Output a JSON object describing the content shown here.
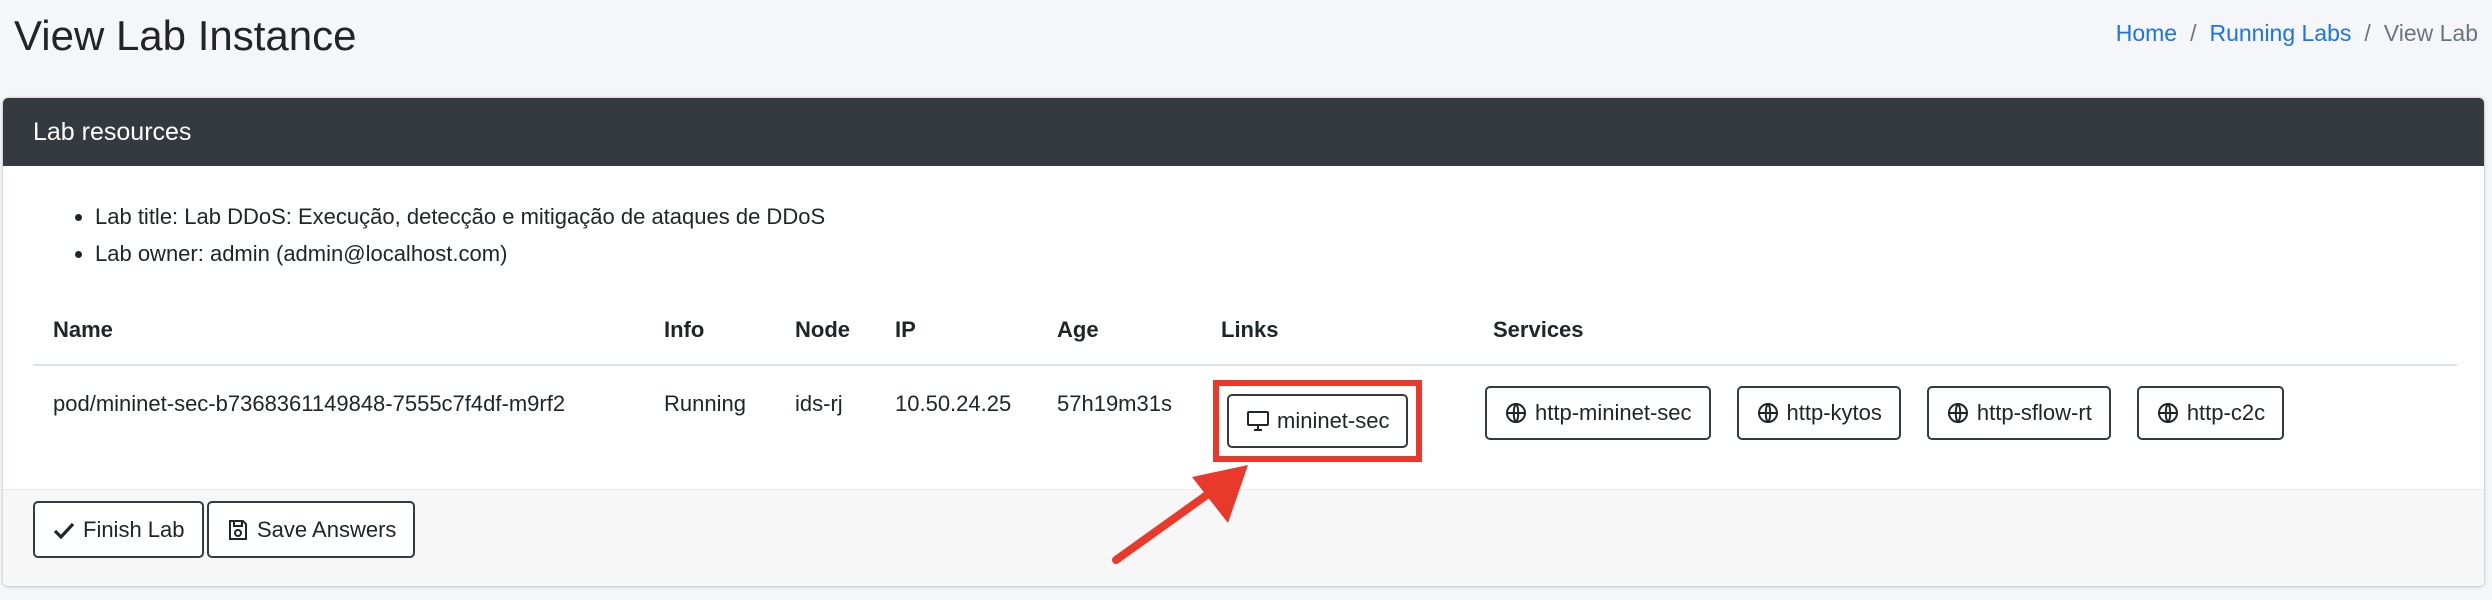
{
  "page": {
    "title": "View Lab Instance"
  },
  "breadcrumb": {
    "home": "Home",
    "running": "Running Labs",
    "current": "View Lab",
    "separator": "/"
  },
  "card": {
    "header": "Lab resources",
    "info": [
      "Lab title: Lab DDoS: Execução, detecção e mitigação de ataques de DDoS",
      "Lab owner: admin (admin@localhost.com)"
    ]
  },
  "table": {
    "columns": [
      "Name",
      "Info",
      "Node",
      "IP",
      "Age",
      "Links",
      "Services"
    ],
    "rows": [
      {
        "name": "pod/mininet-sec-b7368361149848-7555c7f4df-m9rf2",
        "info": "Running",
        "node": "ids-rj",
        "ip": "10.50.24.25",
        "age": "57h19m31s",
        "link": "mininet-sec",
        "services": [
          "http-mininet-sec",
          "http-kytos",
          "http-sflow-rt",
          "http-c2c"
        ]
      }
    ]
  },
  "footer": {
    "finish": "Finish Lab",
    "save": "Save Answers"
  },
  "colors": {
    "header_bg": "#343a40",
    "link": "#1a73e8",
    "highlight": "#e8392a"
  },
  "icons": [
    "desktop-icon",
    "globe-icon",
    "check-icon",
    "floppy-disk-icon",
    "arrow-annotation"
  ]
}
